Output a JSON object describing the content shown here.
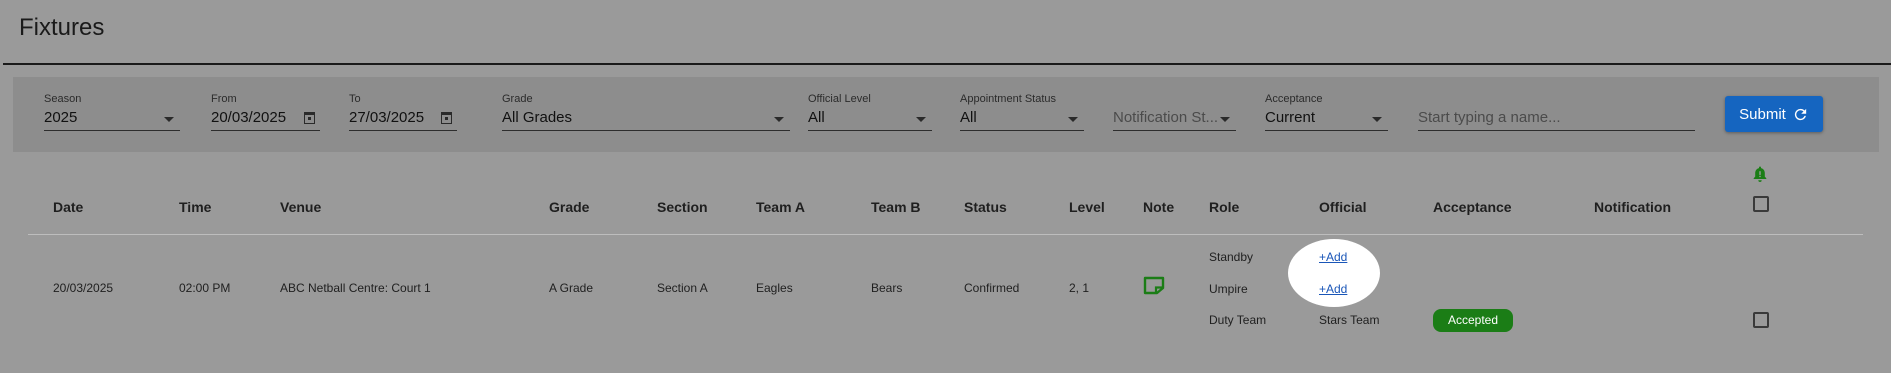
{
  "page": {
    "title": "Fixtures"
  },
  "filters": {
    "season": {
      "label": "Season",
      "value": "2025"
    },
    "from": {
      "label": "From",
      "value": "20/03/2025"
    },
    "to": {
      "label": "To",
      "value": "27/03/2025"
    },
    "grade": {
      "label": "Grade",
      "value": "All Grades"
    },
    "official_level": {
      "label": "Official Level",
      "value": "All"
    },
    "appointment_status": {
      "label": "Appointment Status",
      "value": "All"
    },
    "notification_status": {
      "placeholder": "Notification St..."
    },
    "acceptance": {
      "label": "Acceptance",
      "value": "Current"
    },
    "name_search": {
      "placeholder": "Start typing a name..."
    },
    "submit_label": "Submit"
  },
  "table": {
    "headers": {
      "date": "Date",
      "time": "Time",
      "venue": "Venue",
      "grade": "Grade",
      "section": "Section",
      "team_a": "Team A",
      "team_b": "Team B",
      "status": "Status",
      "level": "Level",
      "note": "Note",
      "role": "Role",
      "official": "Official",
      "acceptance": "Acceptance",
      "notification": "Notification"
    },
    "row": {
      "date": "20/03/2025",
      "time": "02:00 PM",
      "venue": "ABC Netball Centre: Court 1",
      "grade": "A Grade",
      "section": "Section A",
      "team_a": "Eagles",
      "team_b": "Bears",
      "status": "Confirmed",
      "level": "2, 1",
      "appointments": [
        {
          "role": "Standby",
          "official": "+Add"
        },
        {
          "role": "Umpire",
          "official": "+Add"
        },
        {
          "role": "Duty Team",
          "official": "Stars Team",
          "acceptance": "Accepted"
        }
      ]
    }
  },
  "colors": {
    "accent": "#1565c0",
    "success": "#1b7d16",
    "link": "#1a56b8"
  },
  "icons": [
    "calendar-icon",
    "refresh-icon",
    "bell-icon",
    "note-icon",
    "chevron-down-icon"
  ]
}
